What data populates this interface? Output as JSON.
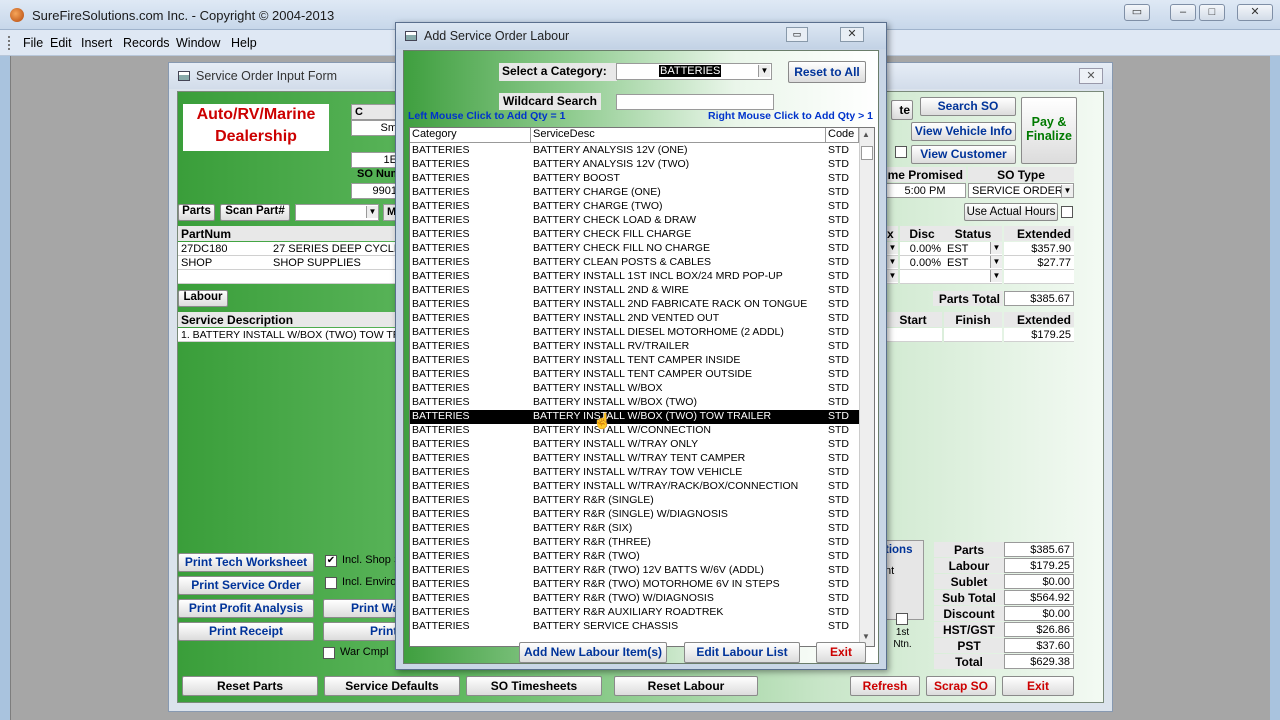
{
  "app": {
    "title": "SureFireSolutions.com Inc. - Copyright © 2004-2013",
    "menu": [
      "File",
      "Edit",
      "Insert",
      "Records",
      "Window",
      "Help"
    ]
  },
  "form": {
    "title": "Service Order Input Form",
    "logo_line1": "Auto/RV/Marine",
    "logo_line2": "Dealership",
    "partial_so_num_label": "SO Num",
    "partial_so_num_value": "9901",
    "partial_field_c": "C",
    "partial_field_sm": "Sm",
    "partial_field_1e": "1E",
    "parts_btn": "Parts",
    "scan_part_btn": "Scan Part#",
    "parts_cols": [
      "PartNum",
      ""
    ],
    "parts_rows": [
      {
        "num": "27DC180",
        "desc": "27 SERIES DEEP CYCLE BA"
      },
      {
        "num": "SHOP",
        "desc": "SHOP SUPPLIES"
      }
    ],
    "labour_btn": "Labour",
    "service_desc_header": "Service Description",
    "service_desc_row": "1. BATTERY  INSTALL  W/BOX (TWO) TOW TR",
    "print_buttons": [
      "Print Tech Worksheet",
      "Print Service Order",
      "Print Profit Analysis",
      "Print Receipt"
    ],
    "checkboxes": [
      {
        "label": "Incl. Shop S",
        "checked": true
      },
      {
        "label": "Incl. Enviro",
        "checked": false
      }
    ],
    "partial_btn_print_wa": "Print Wa",
    "partial_btn_print": "Print",
    "war_cmpl_label": "War Cmpl",
    "right": {
      "partial_te": "te",
      "search_so": "Search SO",
      "view_vehicle_info": "View Vehicle Info",
      "view_customer": "View Customer",
      "pay_finalize": "Pay & Finalize",
      "time_promised_label": "me Promised",
      "time_promised_value": "5:00 PM",
      "so_type_label": "SO Type",
      "so_type_value": "SERVICE ORDER",
      "use_actual_hours": "Use Actual Hours",
      "parts_grid_headers": [
        "x",
        "Disc",
        "Status",
        "Extended"
      ],
      "parts_grid_rows": [
        {
          "disc": "0.00%",
          "status": "EST",
          "ext": "$357.90"
        },
        {
          "disc": "0.00%",
          "status": "EST",
          "ext": "$27.77"
        }
      ],
      "parts_total_label": "Parts Total",
      "parts_total_value": "$385.67",
      "labour_grid_headers": [
        "Start",
        "Finish",
        "Extended"
      ],
      "labour_ext": "$179.25",
      "partial_tions": "tions",
      "partial_nt": "nt",
      "first_ntn": "1st Ntn.",
      "totals": [
        {
          "label": "Parts",
          "value": "$385.67"
        },
        {
          "label": "Labour",
          "value": "$179.25"
        },
        {
          "label": "Sublet",
          "value": "$0.00"
        },
        {
          "label": "Sub Total",
          "value": "$564.92"
        },
        {
          "label": "Discount",
          "value": "$0.00"
        },
        {
          "label": "HST/GST",
          "value": "$26.86"
        },
        {
          "label": "PST",
          "value": "$37.60"
        },
        {
          "label": "Total",
          "value": "$629.38"
        }
      ]
    },
    "bottom_buttons": {
      "reset_parts": "Reset Parts",
      "service_defaults": "Service Defaults",
      "so_timesheets": "SO Timesheets",
      "reset_labour": "Reset Labour",
      "refresh": "Refresh",
      "scrap_so": "Scrap SO",
      "exit": "Exit"
    }
  },
  "dialog": {
    "title": "Add Service Order Labour",
    "select_category_label": "Select a Category:",
    "select_category_value": "BATTERIES",
    "reset_to_all": "Reset to All",
    "wildcard_search_label": "Wildcard Search",
    "wildcard_search_value": "",
    "left_click_hint": "Left Mouse Click to Add Qty = 1",
    "right_click_hint": "Right Mouse Click to Add Qty > 1",
    "columns": [
      "Category",
      "ServiceDesc",
      "Code"
    ],
    "selected_index": 19,
    "rows": [
      {
        "cat": "BATTERIES",
        "desc": "BATTERY  ANALYSIS  12V (ONE)",
        "code": "STD"
      },
      {
        "cat": "BATTERIES",
        "desc": "BATTERY  ANALYSIS  12V (TWO)",
        "code": "STD"
      },
      {
        "cat": "BATTERIES",
        "desc": "BATTERY  BOOST",
        "code": "STD"
      },
      {
        "cat": "BATTERIES",
        "desc": "BATTERY  CHARGE (ONE)",
        "code": "STD"
      },
      {
        "cat": "BATTERIES",
        "desc": "BATTERY  CHARGE (TWO)",
        "code": "STD"
      },
      {
        "cat": "BATTERIES",
        "desc": "BATTERY  CHECK  LOAD & DRAW",
        "code": "STD"
      },
      {
        "cat": "BATTERIES",
        "desc": "BATTERY  CHECK FILL CHARGE",
        "code": "STD"
      },
      {
        "cat": "BATTERIES",
        "desc": "BATTERY  CHECK FILL NO CHARGE",
        "code": "STD"
      },
      {
        "cat": "BATTERIES",
        "desc": "BATTERY  CLEAN POSTS & CABLES",
        "code": "STD"
      },
      {
        "cat": "BATTERIES",
        "desc": "BATTERY  INSTALL  1ST INCL BOX/24 MRD POP-UP",
        "code": "STD"
      },
      {
        "cat": "BATTERIES",
        "desc": "BATTERY  INSTALL  2ND & WIRE",
        "code": "STD"
      },
      {
        "cat": "BATTERIES",
        "desc": "BATTERY  INSTALL  2ND FABRICATE RACK ON TONGUE",
        "code": "STD"
      },
      {
        "cat": "BATTERIES",
        "desc": "BATTERY  INSTALL  2ND VENTED OUT",
        "code": "STD"
      },
      {
        "cat": "BATTERIES",
        "desc": "BATTERY  INSTALL  DIESEL MOTORHOME (2 ADDL)",
        "code": "STD"
      },
      {
        "cat": "BATTERIES",
        "desc": "BATTERY  INSTALL  RV/TRAILER",
        "code": "STD"
      },
      {
        "cat": "BATTERIES",
        "desc": "BATTERY  INSTALL  TENT CAMPER INSIDE",
        "code": "STD"
      },
      {
        "cat": "BATTERIES",
        "desc": "BATTERY  INSTALL  TENT CAMPER OUTSIDE",
        "code": "STD"
      },
      {
        "cat": "BATTERIES",
        "desc": "BATTERY  INSTALL  W/BOX",
        "code": "STD"
      },
      {
        "cat": "BATTERIES",
        "desc": "BATTERY  INSTALL  W/BOX (TWO)",
        "code": "STD"
      },
      {
        "cat": "BATTERIES",
        "desc": "BATTERY  INSTALL  W/BOX (TWO) TOW TRAILER",
        "code": "STD"
      },
      {
        "cat": "BATTERIES",
        "desc": "BATTERY  INSTALL  W/CONNECTION",
        "code": "STD"
      },
      {
        "cat": "BATTERIES",
        "desc": "BATTERY  INSTALL  W/TRAY ONLY",
        "code": "STD"
      },
      {
        "cat": "BATTERIES",
        "desc": "BATTERY  INSTALL  W/TRAY TENT CAMPER",
        "code": "STD"
      },
      {
        "cat": "BATTERIES",
        "desc": "BATTERY  INSTALL  W/TRAY TOW VEHICLE",
        "code": "STD"
      },
      {
        "cat": "BATTERIES",
        "desc": "BATTERY  INSTALL  W/TRAY/RACK/BOX/CONNECTION",
        "code": "STD"
      },
      {
        "cat": "BATTERIES",
        "desc": "BATTERY  R&R  (SINGLE)",
        "code": "STD"
      },
      {
        "cat": "BATTERIES",
        "desc": "BATTERY  R&R  (SINGLE) W/DIAGNOSIS",
        "code": "STD"
      },
      {
        "cat": "BATTERIES",
        "desc": "BATTERY  R&R  (SIX)",
        "code": "STD"
      },
      {
        "cat": "BATTERIES",
        "desc": "BATTERY  R&R  (THREE)",
        "code": "STD"
      },
      {
        "cat": "BATTERIES",
        "desc": "BATTERY  R&R  (TWO)",
        "code": "STD"
      },
      {
        "cat": "BATTERIES",
        "desc": "BATTERY  R&R  (TWO)  12V BATTS W/6V  (ADDL)",
        "code": "STD"
      },
      {
        "cat": "BATTERIES",
        "desc": "BATTERY  R&R  (TWO) MOTORHOME 6V IN STEPS",
        "code": "STD"
      },
      {
        "cat": "BATTERIES",
        "desc": "BATTERY  R&R  (TWO) W/DIAGNOSIS",
        "code": "STD"
      },
      {
        "cat": "BATTERIES",
        "desc": "BATTERY  R&R  AUXILIARY ROADTREK",
        "code": "STD"
      },
      {
        "cat": "BATTERIES",
        "desc": "BATTERY  SERVICE  CHASSIS",
        "code": "STD"
      }
    ],
    "add_new_labour": "Add New Labour Item(s)",
    "edit_labour_list": "Edit Labour List",
    "exit": "Exit"
  }
}
